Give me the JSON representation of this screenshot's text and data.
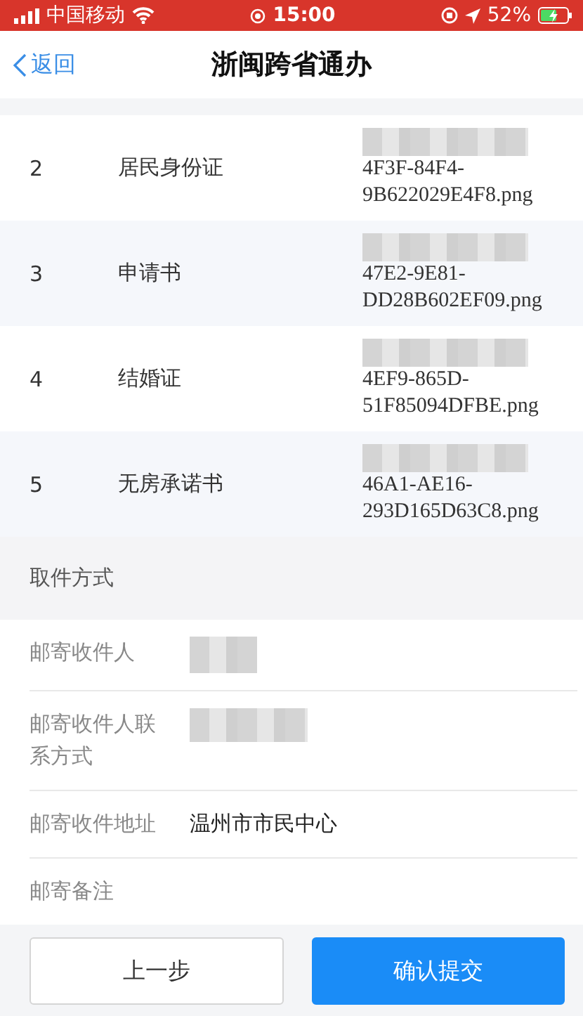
{
  "status_bar": {
    "carrier": "中国移动",
    "time": "15:00",
    "battery": "52%"
  },
  "nav": {
    "back": "返回",
    "title": "浙闽跨省通办"
  },
  "files": [
    {
      "index": "2",
      "name": "居民身份证",
      "file_lines": [
        "4F3F-84F4-",
        "9B622029E4F8.png"
      ],
      "redacted": true
    },
    {
      "index": "3",
      "name": "申请书",
      "file_lines": [
        "47E2-9E81-",
        "DD28B602EF09.png"
      ],
      "redacted": true
    },
    {
      "index": "4",
      "name": "结婚证",
      "file_lines": [
        "4EF9-865D-",
        "51F85094DFBE.png"
      ],
      "redacted": true
    },
    {
      "index": "5",
      "name": "无房承诺书",
      "file_lines": [
        "46A1-AE16-",
        "293D165D63C8.png"
      ],
      "redacted": true
    }
  ],
  "section_title": "取件方式",
  "fields": [
    {
      "label": "邮寄收件人",
      "redacted": true
    },
    {
      "label": "邮寄收件人联系方式",
      "redacted": true
    },
    {
      "label": "邮寄收件地址",
      "value": "温州市市民中心",
      "redacted": false
    },
    {
      "label": "邮寄备注",
      "redacted": false
    }
  ],
  "buttons": [
    {
      "label": "上一步",
      "kind": "secondary"
    },
    {
      "label": "确认提交",
      "kind": "primary"
    }
  ]
}
